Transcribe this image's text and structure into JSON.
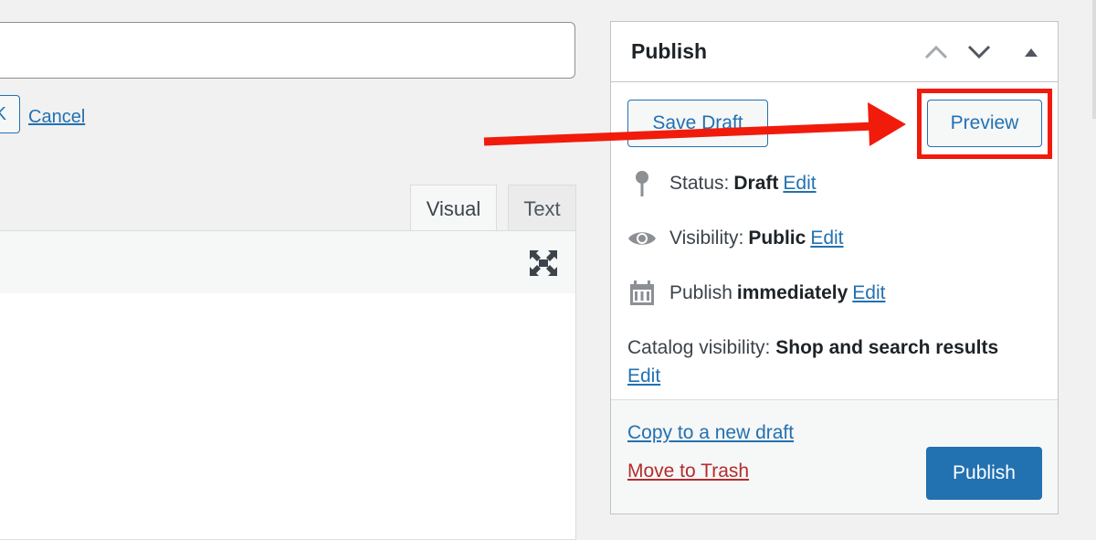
{
  "editor": {
    "ok_label": "OK",
    "cancel_label": "Cancel",
    "tabs": [
      {
        "label": "Visual"
      },
      {
        "label": "Text"
      }
    ],
    "fullscreen_icon": "fullscreen-icon"
  },
  "publish_box": {
    "title": "Publish",
    "save_draft_label": "Save Draft",
    "preview_label": "Preview",
    "status": {
      "label": "Status:",
      "value": "Draft",
      "edit": "Edit"
    },
    "visibility": {
      "label": "Visibility:",
      "value": "Public",
      "edit": "Edit"
    },
    "schedule": {
      "label": "Publish",
      "value": "immediately",
      "edit": "Edit"
    },
    "catalog": {
      "label": "Catalog visibility:",
      "value": "Shop and search results",
      "edit": "Edit"
    },
    "copy_draft_label": "Copy to a new draft",
    "trash_label": "Move to Trash",
    "publish_label": "Publish"
  },
  "colors": {
    "link": "#2271b1",
    "trash": "#b32d2e",
    "annotation": "#f11b0c",
    "primary_button": "#2271b1"
  }
}
